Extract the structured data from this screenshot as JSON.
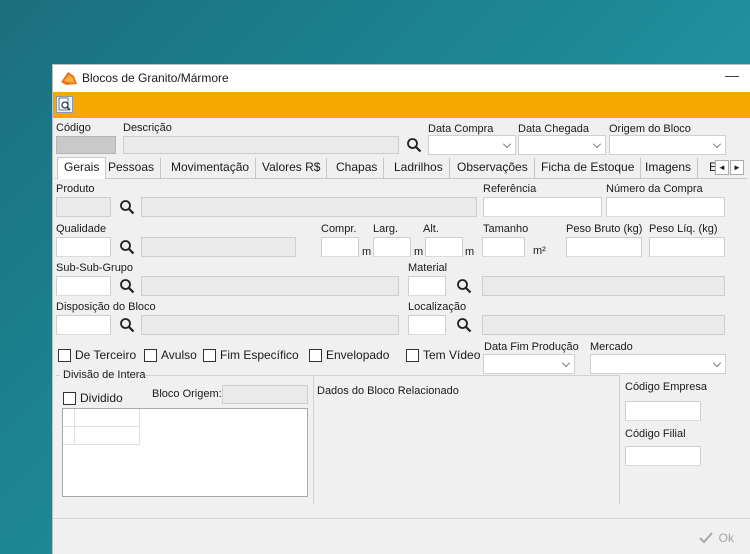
{
  "window": {
    "title": "Blocos de Granito/Mármore",
    "minimize_glyph": "—"
  },
  "header": {
    "codigo_label": "Código",
    "descricao_label": "Descrição",
    "data_compra_label": "Data Compra",
    "data_chegada_label": "Data Chegada",
    "origem_label": "Origem do Bloco"
  },
  "tabs": [
    {
      "label": "Gerais",
      "active": true
    },
    {
      "label": "Pessoas"
    },
    {
      "label": "Movimentação"
    },
    {
      "label": "Valores R$"
    },
    {
      "label": "Chapas"
    },
    {
      "label": "Ladrilhos"
    },
    {
      "label": "Observações"
    },
    {
      "label": "Ficha de Estoque"
    },
    {
      "label": "Imagens"
    },
    {
      "label": "E"
    }
  ],
  "tab_scroll": {
    "left": "◄",
    "right": "►"
  },
  "form": {
    "produto_label": "Produto",
    "referencia_label": "Referência",
    "numero_compra_label": "Número da Compra",
    "qualidade_label": "Qualidade",
    "compr_label": "Compr.",
    "larg_label": "Larg.",
    "alt_label": "Alt.",
    "tamanho_label": "Tamanho",
    "peso_bruto_label": "Peso Bruto (kg)",
    "peso_liq_label": "Peso Líq. (kg)",
    "unit_m": "m",
    "unit_m2": "m²",
    "subsubgrupo_label": "Sub-Sub-Grupo",
    "material_label": "Material",
    "disposicao_label": "Disposição do Bloco",
    "localizacao_label": "Localização"
  },
  "checkboxes": {
    "de_terceiro": "De Terceiro",
    "avulso": "Avulso",
    "fim_especifico": "Fim Específico",
    "envelopado": "Envelopado",
    "tem_video": "Tem Vídeo"
  },
  "extra": {
    "data_fim_producao_label": "Data Fim Produção",
    "mercado_label": "Mercado",
    "divisao_label": "Divisão de Intera",
    "dividido_label": "Dividido",
    "bloco_origem_label": "Bloco Origem:",
    "dados_bloco_label": "Dados do Bloco Relacionado",
    "codigo_empresa_label": "Código Empresa",
    "codigo_filial_label": "Código Filial"
  },
  "footer": {
    "ok_label": "Ok"
  },
  "colors": {
    "toolbar": "#f6a800",
    "window_bg": "#f0f0f0"
  },
  "icons": [
    "app-icon",
    "document-search-icon",
    "search-icon",
    "checkmark-icon",
    "chevron-down-icon"
  ]
}
